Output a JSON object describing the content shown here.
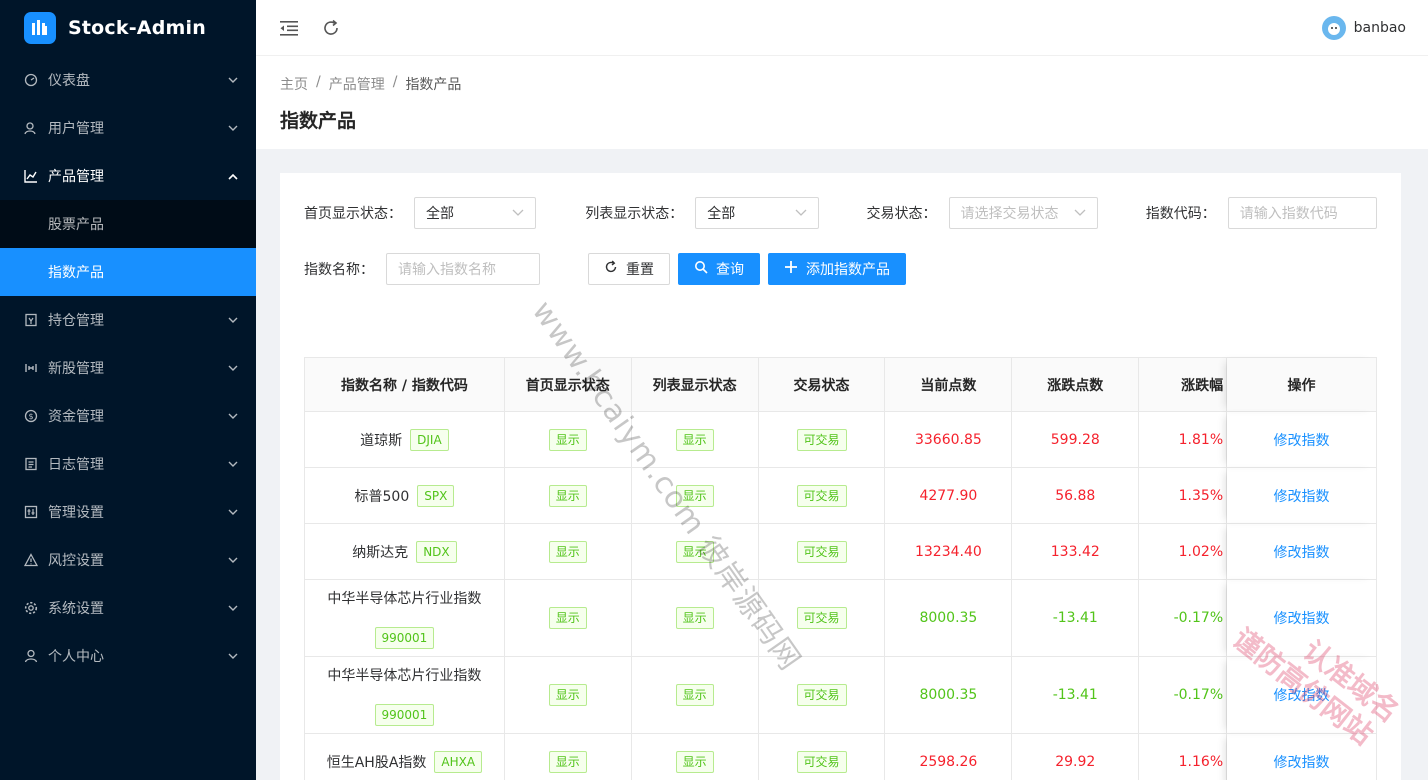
{
  "app": {
    "title": "Stock-Admin"
  },
  "sidebar": {
    "items": [
      {
        "label": "仪表盘",
        "icon": "dashboard-icon"
      },
      {
        "label": "用户管理",
        "icon": "user-manage-icon"
      },
      {
        "label": "产品管理",
        "icon": "chart-icon",
        "open": true,
        "children": [
          {
            "label": "股票产品"
          },
          {
            "label": "指数产品",
            "active": true
          }
        ]
      },
      {
        "label": "持仓管理",
        "icon": "position-icon"
      },
      {
        "label": "新股管理",
        "icon": "ipo-icon"
      },
      {
        "label": "资金管理",
        "icon": "money-icon"
      },
      {
        "label": "日志管理",
        "icon": "log-icon"
      },
      {
        "label": "管理设置",
        "icon": "admin-settings-icon"
      },
      {
        "label": "风控设置",
        "icon": "warning-icon"
      },
      {
        "label": "系统设置",
        "icon": "gear-icon"
      },
      {
        "label": "个人中心",
        "icon": "person-icon"
      }
    ]
  },
  "header": {
    "username": "banbao"
  },
  "page": {
    "breadcrumb": [
      "主页",
      "产品管理",
      "指数产品"
    ],
    "title": "指数产品"
  },
  "filters": {
    "home_status_label": "首页显示状态：",
    "home_status_value": "全部",
    "list_status_label": "列表显示状态：",
    "list_status_value": "全部",
    "trade_status_label": "交易状态：",
    "trade_status_placeholder": "请选择交易状态",
    "code_label": "指数代码：",
    "code_placeholder": "请输入指数代码",
    "name_label": "指数名称：",
    "name_placeholder": "请输入指数名称",
    "reset_label": "重置",
    "search_label": "查询",
    "add_label": "添加指数产品"
  },
  "table": {
    "columns": [
      "指数名称 / 指数代码",
      "首页显示状态",
      "列表显示状态",
      "交易状态",
      "当前点数",
      "涨跌点数",
      "涨跌幅",
      "操作"
    ],
    "rows": [
      {
        "name": "道琼斯",
        "code": "DJIA",
        "home": "显示",
        "list": "显示",
        "trade": "可交易",
        "price": "33660.85",
        "change": "599.28",
        "pct": "1.81%",
        "dir": "up",
        "action": "修改指数"
      },
      {
        "name": "标普500",
        "code": "SPX",
        "home": "显示",
        "list": "显示",
        "trade": "可交易",
        "price": "4277.90",
        "change": "56.88",
        "pct": "1.35%",
        "dir": "up",
        "action": "修改指数"
      },
      {
        "name": "纳斯达克",
        "code": "NDX",
        "home": "显示",
        "list": "显示",
        "trade": "可交易",
        "price": "13234.40",
        "change": "133.42",
        "pct": "1.02%",
        "dir": "up",
        "action": "修改指数"
      },
      {
        "name": "中华半导体芯片行业指数",
        "code": "990001",
        "home": "显示",
        "list": "显示",
        "trade": "可交易",
        "price": "8000.35",
        "change": "-13.41",
        "pct": "-0.17%",
        "dir": "down",
        "action": "修改指数"
      },
      {
        "name": "中华半导体芯片行业指数",
        "code": "990001",
        "home": "显示",
        "list": "显示",
        "trade": "可交易",
        "price": "8000.35",
        "change": "-13.41",
        "pct": "-0.17%",
        "dir": "down",
        "action": "修改指数"
      },
      {
        "name": "恒生AH股A指数",
        "code": "AHXA",
        "home": "显示",
        "list": "显示",
        "trade": "可交易",
        "price": "2598.26",
        "change": "29.92",
        "pct": "1.16%",
        "dir": "up",
        "action": "修改指数"
      }
    ]
  },
  "watermarks": {
    "line1": "www.bcaiym.com 彼岸源码网",
    "line2": "认准域名",
    "line3": "谨防高仿网站"
  }
}
